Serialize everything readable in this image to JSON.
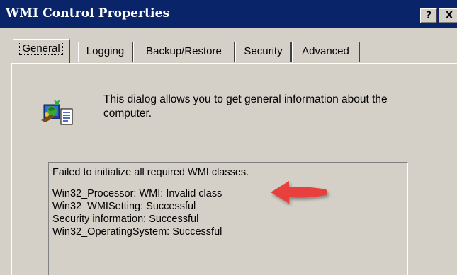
{
  "window": {
    "title": "WMI Control Properties",
    "help_glyph": "?",
    "close_glyph": "X"
  },
  "tabs": [
    {
      "label": "General",
      "active": true
    },
    {
      "label": "Logging",
      "active": false
    },
    {
      "label": "Backup/Restore",
      "active": false
    },
    {
      "label": "Security",
      "active": false
    },
    {
      "label": "Advanced",
      "active": false
    }
  ],
  "general": {
    "icon": "wmi-computer-icon",
    "description": "This dialog allows you to get general information about the computer.",
    "status_header": "Failed to initialize all required WMI classes.",
    "status_lines": [
      "Win32_Processor: WMI: Invalid class",
      "Win32_WMISetting: Successful",
      "Security information: Successful",
      "Win32_OperatingSystem: Successful"
    ]
  },
  "annotation": {
    "type": "red-arrow",
    "color": "#e8413c"
  },
  "colors": {
    "titlebar": "#0a246a",
    "face": "#d4d0c8"
  }
}
